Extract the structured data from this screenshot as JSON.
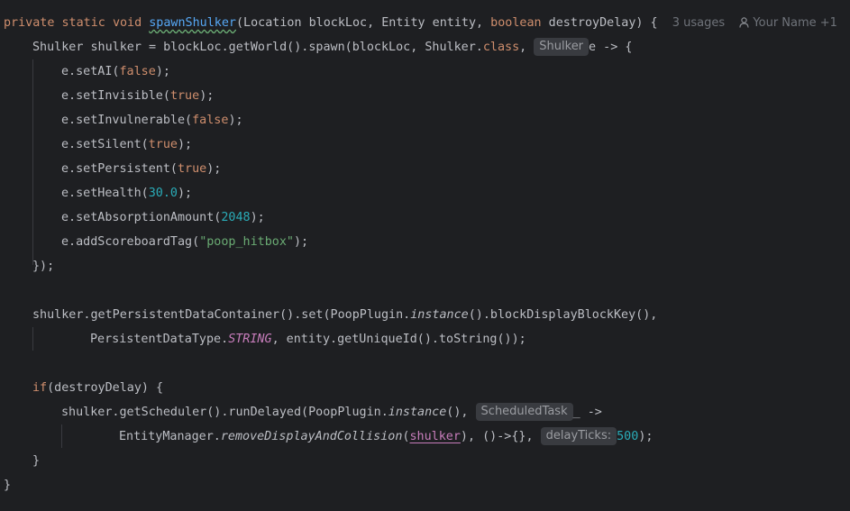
{
  "code": {
    "l1": {
      "private": "private",
      "static": "static",
      "void": "void",
      "method": "spawnShulker",
      "open": "(Location blockLoc, Entity entity, ",
      "boolean": "boolean",
      "rest": " destroyDelay) {",
      "usages": "3 usages",
      "author": "Your Name +1"
    },
    "l2": {
      "a": "Shulker shulker = blockLoc.getWorld().spawn(blockLoc, Shulker.",
      "class": "class",
      "b": ", ",
      "hint": "Shulker",
      "c": "e -> {"
    },
    "l3": {
      "a": "e.setAI(",
      "v": "false",
      "b": ");"
    },
    "l4": {
      "a": "e.setInvisible(",
      "v": "true",
      "b": ");"
    },
    "l5": {
      "a": "e.setInvulnerable(",
      "v": "false",
      "b": ");"
    },
    "l6": {
      "a": "e.setSilent(",
      "v": "true",
      "b": ");"
    },
    "l7": {
      "a": "e.setPersistent(",
      "v": "true",
      "b": ");"
    },
    "l8": {
      "a": "e.setHealth(",
      "v": "30.0",
      "b": ");"
    },
    "l9": {
      "a": "e.setAbsorptionAmount(",
      "v": "2048",
      "b": ");"
    },
    "l10": {
      "a": "e.addScoreboardTag(",
      "v": "\"poop_hitbox\"",
      "b": ");"
    },
    "l11": {
      "a": "});"
    },
    "l13": {
      "a": "shulker.getPersistentDataContainer().set(PoopPlugin.",
      "i": "instance",
      "b": "().blockDisplayBlockKey(),"
    },
    "l14": {
      "a": "PersistentDataType.",
      "c": "STRING",
      "b": ", entity.getUniqueId().toString());"
    },
    "l16": {
      "if": "if",
      "a": "(destroyDelay) {"
    },
    "l17": {
      "a": "shulker.getScheduler().runDelayed(PoopPlugin.",
      "i": "instance",
      "b": "(), ",
      "hint": "ScheduledTask",
      "c": "_ ->"
    },
    "l18": {
      "a": "EntityManager.",
      "m": "removeDisplayAndCollision",
      "p": "(",
      "ref": "shulker",
      "b": "), ()->{}, ",
      "hint": "delayTicks:",
      "v": "500",
      "c": ");"
    },
    "l19": {
      "a": "}"
    },
    "l20": {
      "a": "}"
    }
  }
}
